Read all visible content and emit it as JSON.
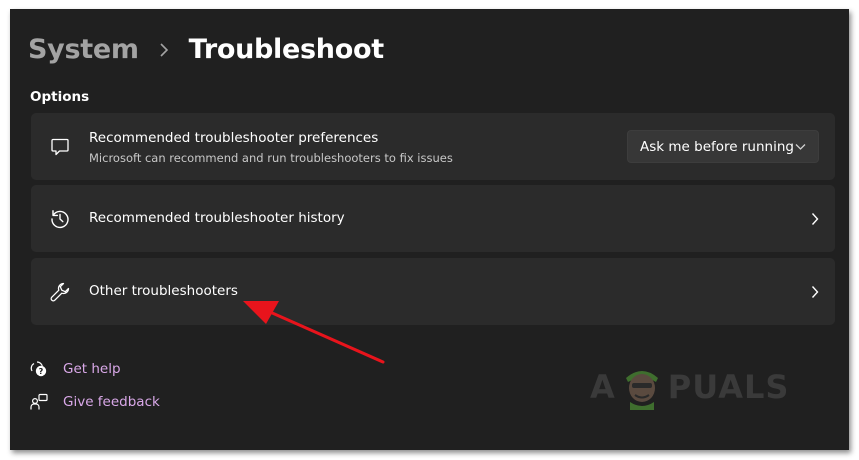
{
  "breadcrumb": {
    "parent": "System",
    "current": "Troubleshoot"
  },
  "section": {
    "label": "Options"
  },
  "cards": [
    {
      "title": "Recommended troubleshooter preferences",
      "subtitle": "Microsoft can recommend and run troubleshooters to fix issues",
      "icon": "chat-bubble-icon",
      "dropdown": {
        "selected": "Ask me before running"
      }
    },
    {
      "title": "Recommended troubleshooter history",
      "icon": "history-icon"
    },
    {
      "title": "Other troubleshooters",
      "icon": "wrench-icon"
    }
  ],
  "links": [
    {
      "label": "Get help",
      "icon": "help-chat-icon"
    },
    {
      "label": "Give feedback",
      "icon": "feedback-icon"
    }
  ],
  "watermark": {
    "left": "A",
    "right": "PUALS"
  },
  "colors": {
    "background": "#202020",
    "card": "#2b2b2b",
    "link": "#d9a8e8",
    "annotation_arrow": "#e8141c"
  }
}
